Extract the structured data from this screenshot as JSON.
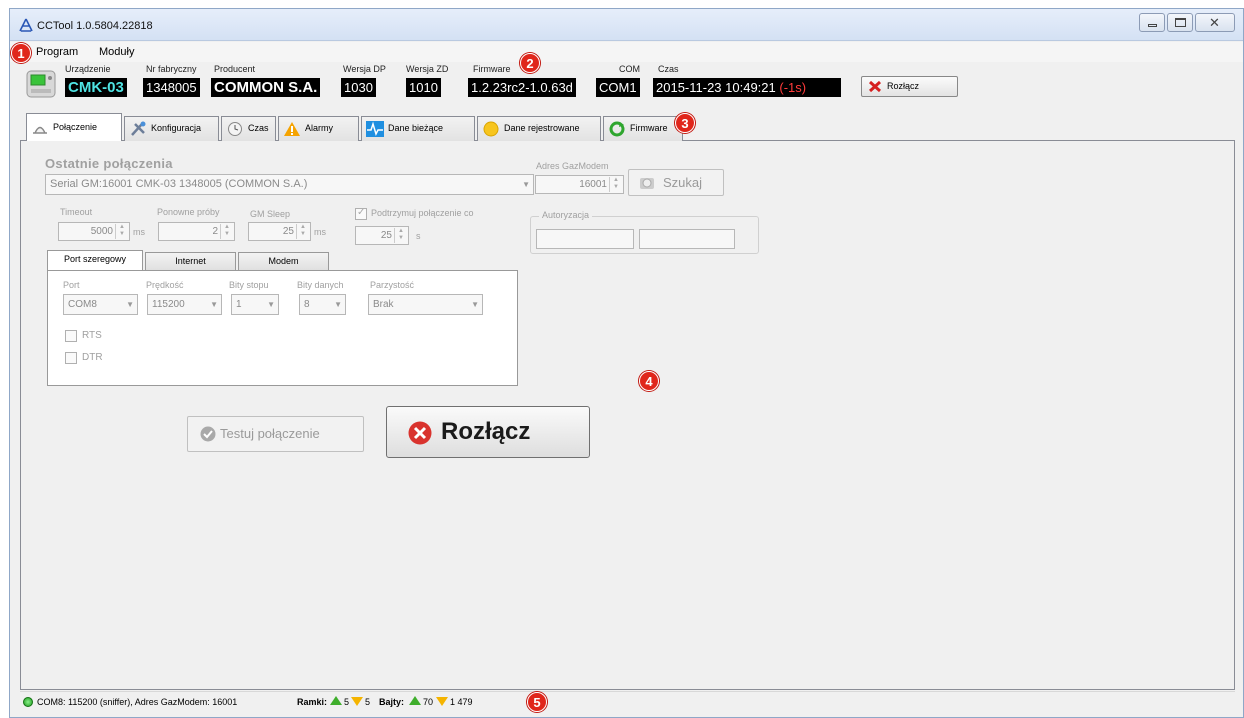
{
  "window": {
    "title": "CCTool 1.0.5804.22818"
  },
  "menu": {
    "items": [
      "Program",
      "Moduły"
    ]
  },
  "badges": [
    "1",
    "2",
    "3",
    "4",
    "5"
  ],
  "device": {
    "labels": {
      "device": "Urządzenie",
      "serial": "Nr fabryczny",
      "producer": "Producent",
      "dp_version": "Wersja DP",
      "zd_version": "Wersja ZD",
      "firmware": "Firmware",
      "com": "COM",
      "time": "Czas"
    },
    "values": {
      "device": "CMK-03",
      "serial": "1348005",
      "producer": "COMMON S.A.",
      "dp_version": "1030",
      "zd_version": "1010",
      "firmware": "1.2.23rc2-1.0.63d",
      "com": "COM1",
      "time": "2015-11-23  10:49:21",
      "time_offset": "(-1s)"
    },
    "disconnect_label": "Rozłącz"
  },
  "tabs": [
    {
      "label": "Połączenie",
      "icon": "connection-icon",
      "active": true
    },
    {
      "label": "Konfiguracja",
      "icon": "tools-icon"
    },
    {
      "label": "Czas",
      "icon": "clock-icon"
    },
    {
      "label": "Alarmy",
      "icon": "warning-icon"
    },
    {
      "label": "Dane bieżące",
      "icon": "pulse-icon"
    },
    {
      "label": "Dane rejestrowane",
      "icon": "archive-icon"
    },
    {
      "label": "Firmware",
      "icon": "refresh-icon"
    }
  ],
  "connection": {
    "recent_title": "Ostatnie połączenia",
    "recent_value": "Serial GM:16001 CMK-03 1348005 (COMMON S.A.)",
    "gazmodem_label": "Adres GazModem",
    "gazmodem_value": "16001",
    "search_label": "Szukaj",
    "timeout_label": "Timeout",
    "timeout_value": "5000",
    "timeout_unit": "ms",
    "retries_label": "Ponowne próby",
    "retries_value": "2",
    "sleep_label": "GM Sleep",
    "sleep_value": "25",
    "sleep_unit": "ms",
    "keepalive_label": "Podtrzymuj połączenie co",
    "keepalive_value": "25",
    "keepalive_unit": "s",
    "auth_label": "Autoryzacja",
    "subtabs": [
      "Port szeregowy",
      "Internet",
      "Modem"
    ],
    "serial": {
      "port_label": "Port",
      "port_value": "COM8",
      "speed_label": "Prędkość",
      "speed_value": "115200",
      "stopbits_label": "Bity stopu",
      "stopbits_value": "1",
      "databits_label": "Bity danych",
      "databits_value": "8",
      "parity_label": "Parzystość",
      "parity_value": "Brak",
      "rts_label": "RTS",
      "dtr_label": "DTR"
    },
    "test_button": "Testuj połączenie",
    "disconnect_button": "Rozłącz"
  },
  "status": {
    "connection": "COM8: 115200 (sniffer), Adres GazModem: 16001",
    "frames_label": "Ramki:",
    "frames_up": "5",
    "frames_down": "5",
    "bytes_label": "Bajty:",
    "bytes_up": "70",
    "bytes_down": "1 479"
  }
}
